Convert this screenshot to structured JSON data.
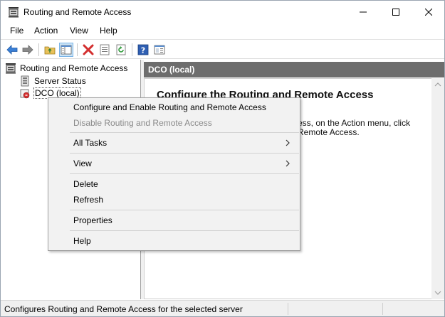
{
  "window": {
    "title": "Routing and Remote Access"
  },
  "menubar": {
    "items": [
      "File",
      "Action",
      "View",
      "Help"
    ]
  },
  "toolbar": {
    "buttons": [
      "back-icon",
      "forward-icon",
      "up-folder-icon",
      "show-hide-tree-icon",
      "delete-icon",
      "properties-icon",
      "refresh-icon",
      "help-icon",
      "console-view-icon"
    ]
  },
  "tree": {
    "root_label": "Routing and Remote Access",
    "items": [
      {
        "label": "Server Status"
      },
      {
        "label": "DCO (local)"
      }
    ]
  },
  "right_pane": {
    "header": "DCO (local)",
    "heading": "Configure the Routing and Remote Access",
    "body_fragment_1": "ess, on the Action menu, click",
    "body_fragment_2": "Remote Access."
  },
  "context_menu": {
    "items": [
      {
        "label": "Configure and Enable Routing and Remote Access",
        "disabled": false
      },
      {
        "label": "Disable Routing and Remote Access",
        "disabled": true
      },
      {
        "label": "All Tasks",
        "submenu": true
      },
      {
        "label": "View",
        "submenu": true
      },
      {
        "label": "Delete"
      },
      {
        "label": "Refresh"
      },
      {
        "label": "Properties"
      },
      {
        "label": "Help"
      }
    ]
  },
  "statusbar": {
    "text": "Configures Routing and Remote Access for the selected server"
  },
  "colors": {
    "header_bg": "#6d6d6d",
    "menu_bg": "#f2f2f2",
    "disabled_text": "#8a8a8a"
  }
}
